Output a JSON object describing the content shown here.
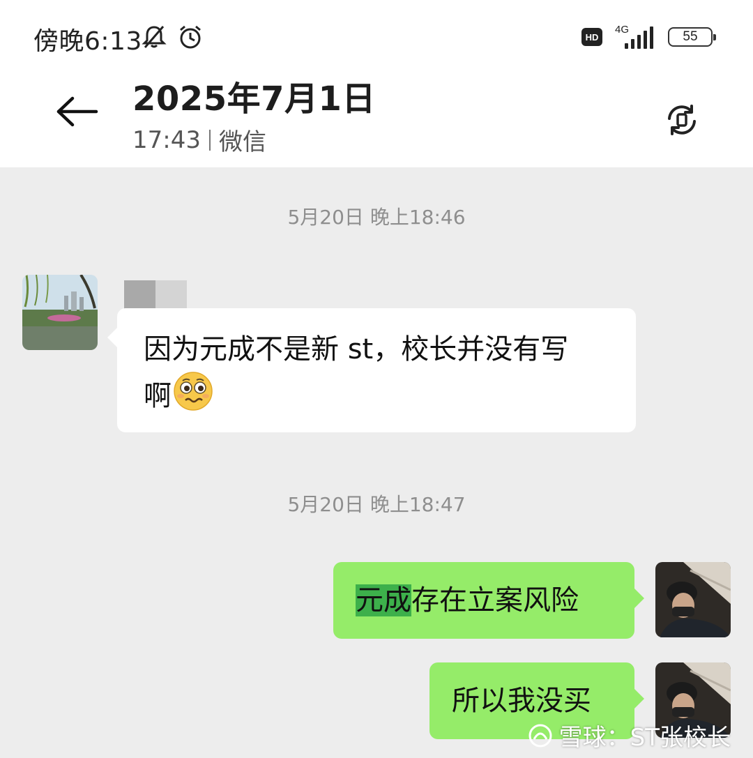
{
  "status_bar": {
    "time": "傍晚6:13",
    "hd_label": "HD",
    "network": "4G",
    "battery": "55"
  },
  "header": {
    "title": "2025年7月1日",
    "time": "17:43",
    "source": "微信"
  },
  "messages": [
    {
      "type": "timestamp",
      "text": "5月20日 晚上18:46"
    },
    {
      "type": "incoming",
      "text_main": "因为元成不是新 st，校长并没有写",
      "text_end": "啊"
    },
    {
      "type": "timestamp",
      "text": "5月20日 晚上18:47"
    },
    {
      "type": "outgoing",
      "highlight": "元成",
      "text_rest": "存在立案风险"
    },
    {
      "type": "outgoing",
      "text": "所以我没买"
    }
  ],
  "watermark": {
    "text": "雪球：ST张校长"
  },
  "colors": {
    "chat_background": "#ededed",
    "outgoing_bubble": "#95ec69",
    "incoming_bubble": "#ffffff",
    "highlight": "#3db04b"
  },
  "icons": [
    "muted-bell-icon",
    "alarm-icon",
    "back-arrow-icon",
    "rotate-screen-icon",
    "worried-emoji-icon",
    "snowball-logo-icon"
  ]
}
